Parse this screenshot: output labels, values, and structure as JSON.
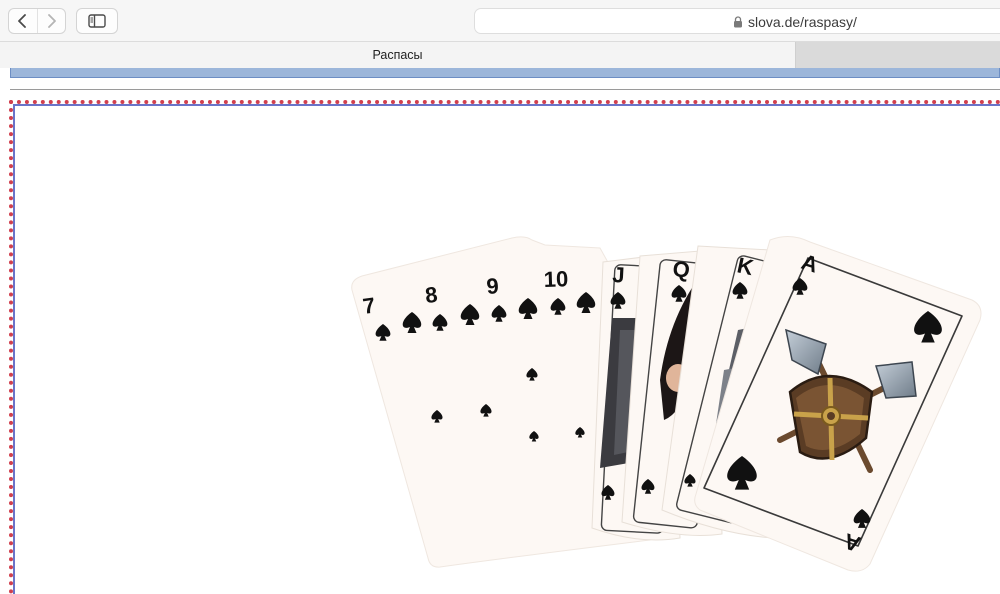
{
  "toolbar": {
    "back_icon": "chevron-left-icon",
    "forward_icon": "chevron-right-icon",
    "sidebar_icon": "sidebar-icon",
    "lock_icon": "lock-icon",
    "url": "slova.de/raspasy/"
  },
  "tabs": [
    {
      "label": "Распасы",
      "active": true
    },
    {
      "label": "",
      "active": false
    }
  ],
  "content": {
    "image_icon": "playing-cards-fan-image",
    "cards": [
      {
        "rank": "7",
        "suit": "spades"
      },
      {
        "rank": "8",
        "suit": "spades"
      },
      {
        "rank": "9",
        "suit": "spades"
      },
      {
        "rank": "10",
        "suit": "spades"
      },
      {
        "rank": "J",
        "suit": "spades"
      },
      {
        "rank": "Q",
        "suit": "spades"
      },
      {
        "rank": "K",
        "suit": "spades"
      },
      {
        "rank": "A",
        "suit": "spades"
      }
    ]
  },
  "colors": {
    "frame_dotted": "#d1404f",
    "frame_inner": "#6a74c9",
    "strip_blue": "#9cb6da",
    "card_face": "#fdf8f4"
  }
}
